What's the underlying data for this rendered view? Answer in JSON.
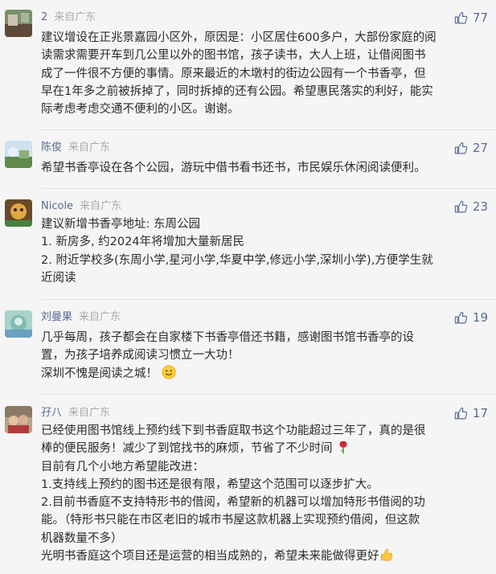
{
  "comments": [
    {
      "user": "2",
      "origin": "来自广东",
      "likes": "77",
      "lines": [
        "建议增设在正兆景嘉园小区外，原因是：小区居住600多户，大部份家庭的阅",
        "读需求需要开车到几公里以外的图书馆，孩子读书，大人上班，让借阅图书",
        "成了一件很不方便的事情。原来最近的木墩村的街边公园有一个书香亭，但",
        "早在1年多之前被拆掉了，同时拆掉的还有公园。希望惠民落实的利好，能实",
        "际考虑考虑交通不便利的小区。谢谢。"
      ]
    },
    {
      "user": "陈俊",
      "origin": "来自广东",
      "likes": "27",
      "lines": [
        "希望书香亭设在各个公园，游玩中借书看书还书，市民娱乐休闲阅读便利。"
      ]
    },
    {
      "user": "Nicole",
      "origin": "来自广东",
      "likes": "23",
      "lines": [
        "建议新增书香亭地址: 东周公园",
        "1. 新房多, 约2024年将增加大量新居民",
        "2. 附近学校多(东周小学,星河小学,华夏中学,修远小学,深圳小学),方便学生就",
        "近阅读"
      ]
    },
    {
      "user": "刘曼果",
      "origin": "来自广东",
      "likes": "19",
      "lines": [
        "几乎每周，孩子都会在自家楼下书香亭借还书籍，感谢图书馆书香亭的设",
        "置，为孩子培养成阅读习惯立一大功！",
        "深圳不愧是阅读之城！"
      ]
    },
    {
      "user": "孖八",
      "origin": "来自广东",
      "likes": "17",
      "lines": [
        "已经使用图书馆线上预约线下到书香庭取书这个功能超过三年了，真的是很",
        "棒的便民服务！减少了到馆找书的麻烦，节省了不少时间",
        "目前有几个小地方希望能改进：",
        "1.支持线上预约的图书还是很有限，希望这个范围可以逐步扩大。",
        "2.目前书香庭不支持特形书的借阅，希望新的机器可以增加特形书借阅的功",
        "能。（特形书只能在市区老旧的城市书屋这款机器上实现预约借阅，但这款",
        "机器数量不多）",
        "光明书香庭这个项目还是运营的相当成熟的，希望未来能做得更好"
      ]
    }
  ],
  "icons": {
    "like": "thumbs-up-icon",
    "smile": "smiling-face-emoji",
    "rose": "rose-emoji",
    "thumbs": "thumbs-up-emoji"
  },
  "colors": {
    "username": "#576b95",
    "origin": "#aaaaaa",
    "like": "#576b95",
    "text": "#2b2b2b",
    "background": "#f5f5f5"
  }
}
